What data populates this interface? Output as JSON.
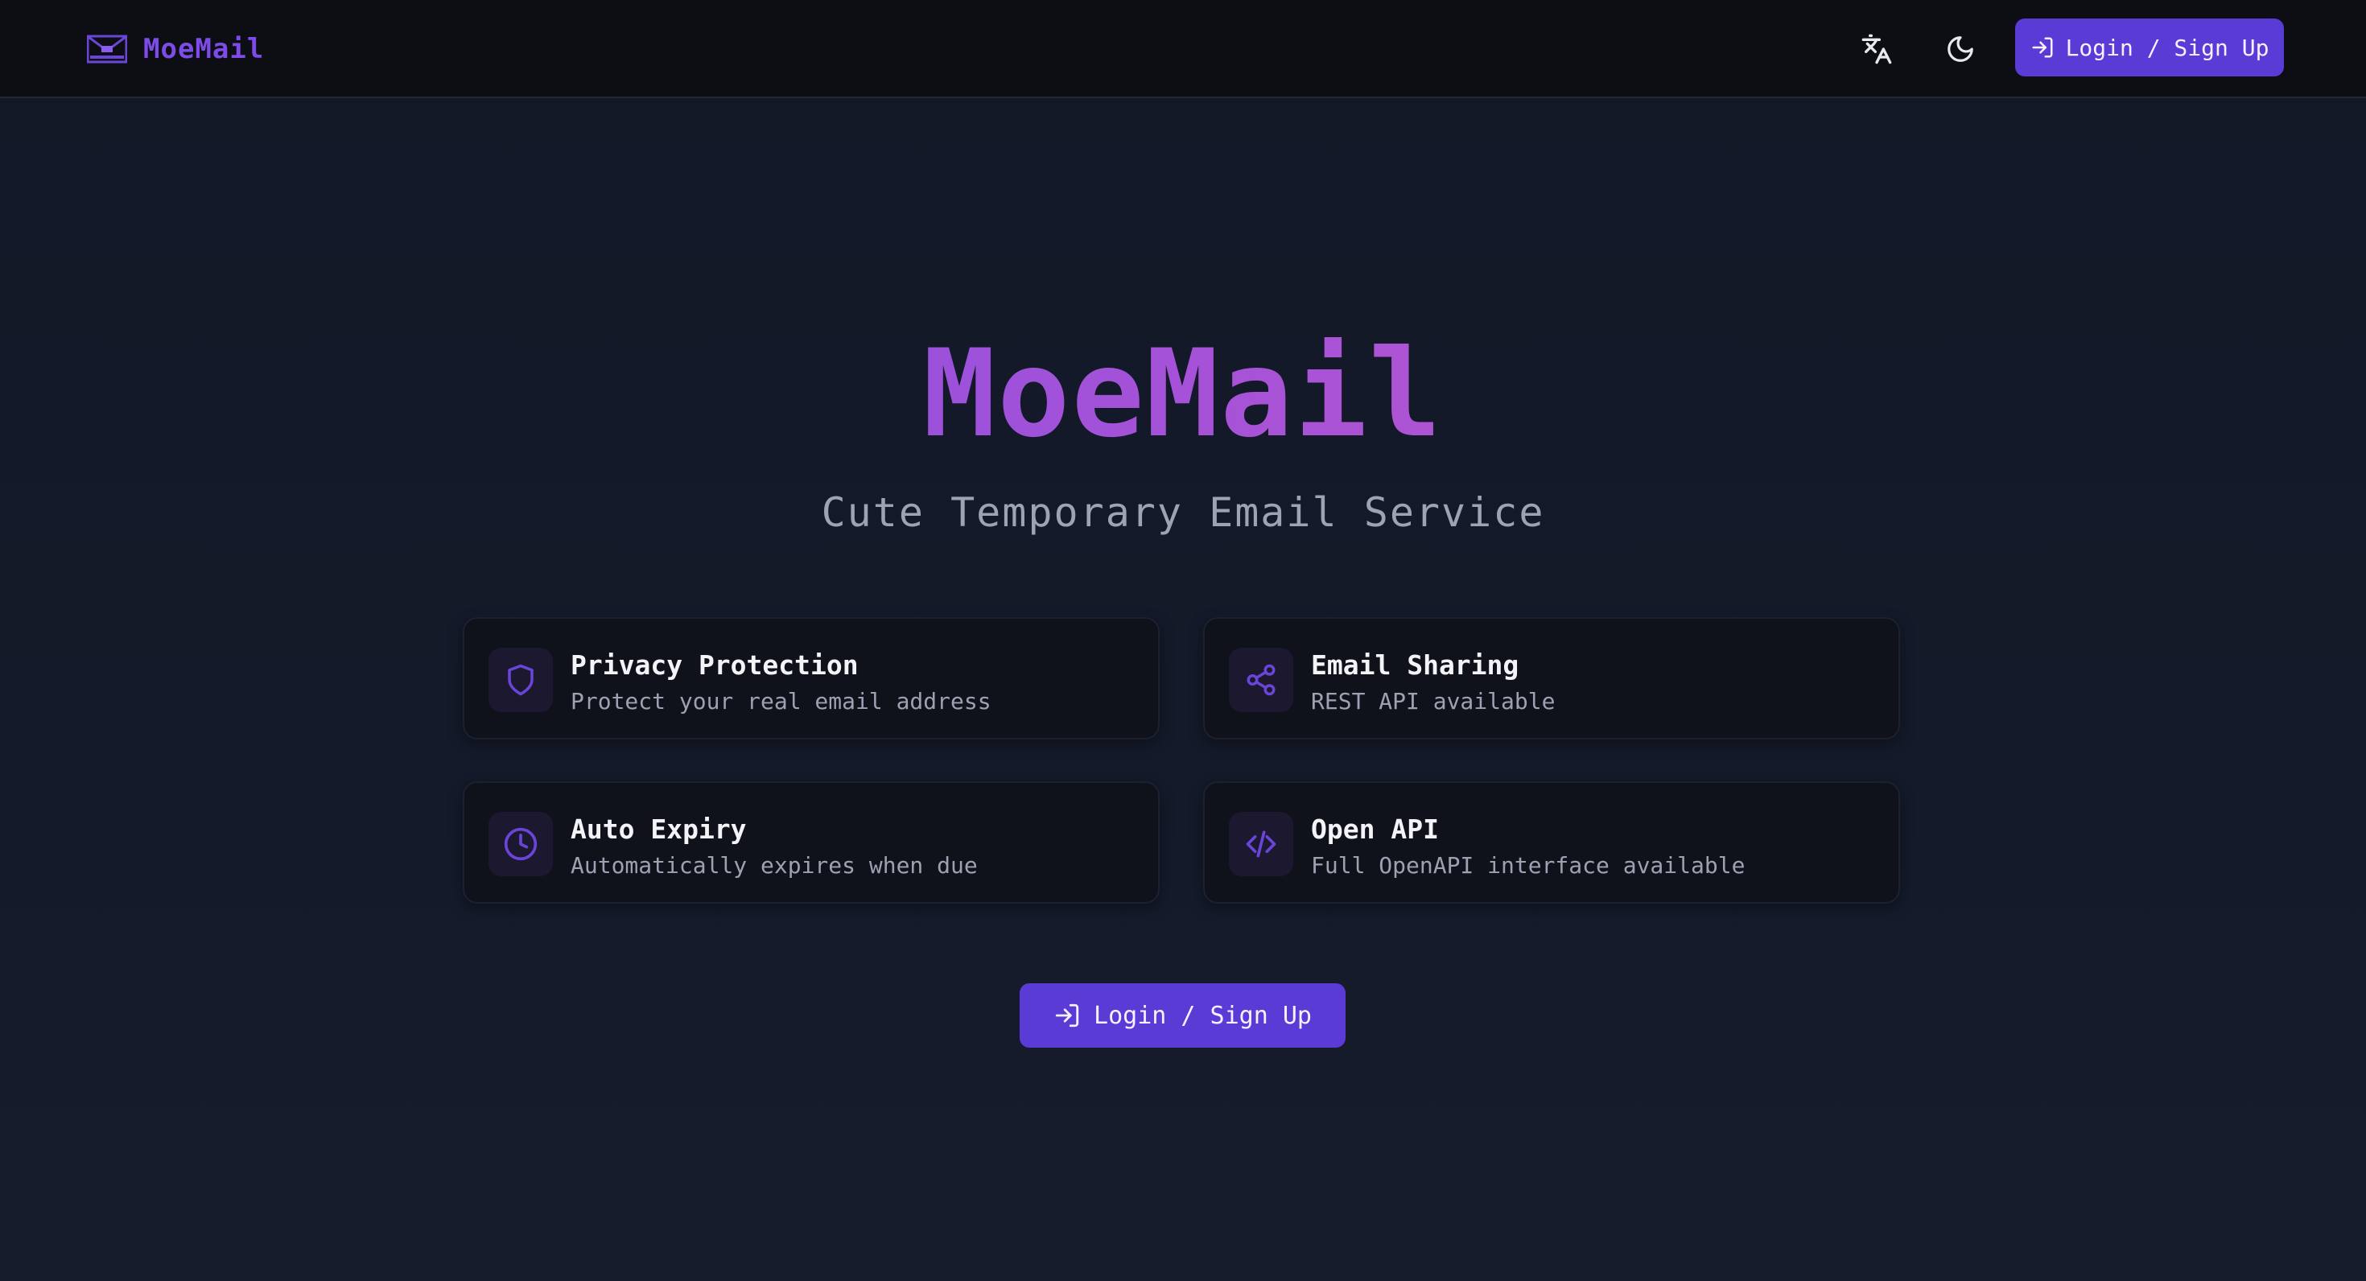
{
  "header": {
    "brand_name": "MoeMail",
    "translate_icon": "translate-icon",
    "theme_icon": "moon-icon",
    "login_label": "Login / Sign Up"
  },
  "hero": {
    "title": "MoeMail",
    "subtitle": "Cute Temporary Email Service"
  },
  "features": [
    {
      "icon": "shield-icon",
      "title": "Privacy Protection",
      "description": "Protect your real email address"
    },
    {
      "icon": "share-icon",
      "title": "Email Sharing",
      "description": "REST API available"
    },
    {
      "icon": "clock-icon",
      "title": "Auto Expiry",
      "description": "Automatically expires when due"
    },
    {
      "icon": "code-icon",
      "title": "Open API",
      "description": "Full OpenAPI interface available"
    }
  ],
  "cta": {
    "login_label": "Login / Sign Up"
  },
  "colors": {
    "accent": "#5b3bd6",
    "brand": "#7d4be8",
    "gradient_end": "#c958c4",
    "background": "#141a29",
    "topbar": "#0c0e14",
    "card": "#0f121b"
  }
}
